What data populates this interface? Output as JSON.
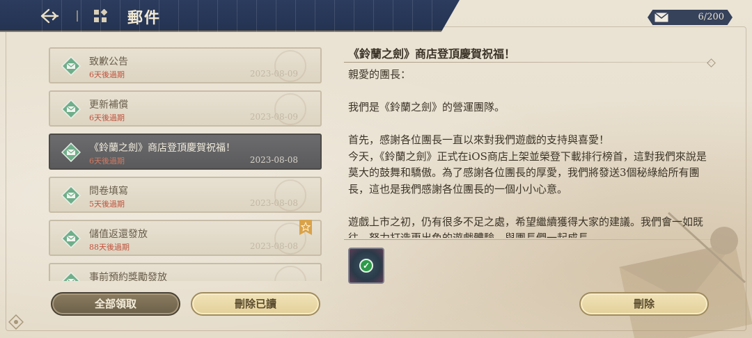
{
  "header": {
    "title": "郵件",
    "back_icon": "back-arrow-icon",
    "menu_icon": "mail-menu-icon"
  },
  "counter": {
    "icon": "envelope-icon",
    "value": "6/200"
  },
  "mails": [
    {
      "title": "致歉公告",
      "expire": "6天後過期",
      "date": "2023-08-09",
      "selected": false,
      "starred": false
    },
    {
      "title": "更新補償",
      "expire": "6天後過期",
      "date": "2023-08-09",
      "selected": false,
      "starred": false
    },
    {
      "title": "《鈴蘭之劍》商店登頂慶賀祝福！",
      "expire": "6天後過期",
      "date": "2023-08-08",
      "selected": true,
      "starred": false
    },
    {
      "title": "問卷填寫",
      "expire": "5天後過期",
      "date": "2023-08-08",
      "selected": false,
      "starred": false
    },
    {
      "title": "儲值返還發放",
      "expire": "88天後過期",
      "date": "2023-08-08",
      "selected": false,
      "starred": true
    },
    {
      "title": "事前預約獎勵發放",
      "expire": "",
      "date": "",
      "selected": false,
      "starred": false
    }
  ],
  "buttons": {
    "claim_all": "全部領取",
    "delete_read": "刪除已讀",
    "delete": "刪除"
  },
  "detail": {
    "title": "《鈴蘭之劍》商店登頂慶賀祝福！",
    "greeting": "親愛的團長：",
    "p1": "我們是《鈴蘭之劍》的營運團隊。",
    "p2a": "首先，感謝各位團長一直以來對我們遊戲的支持與喜愛！",
    "p2b": "今天，《鈴蘭之劍》正式在iOS商店上架並榮登下載排行榜首，這對我們來說是莫大的鼓舞和驕傲。為了感謝各位團長的厚愛，我們將發送3個秘綠給所有團長，這也是我們感謝各位團長的一個小小心意。",
    "p3": "遊戲上市之初，仍有很多不足之處，希望繼續獲得大家的建議。我們會一如既往，努力打造更出色的遊戲體驗，與團長們一起成長",
    "attachment_icon": "reward-item-icon",
    "claimed_icon": "check-icon"
  },
  "colors": {
    "header_bg": "#2c3c5e",
    "selected_bg": "#5f5f61",
    "expire_red": "#c0533d",
    "btn_gold": "#e3d09a"
  }
}
